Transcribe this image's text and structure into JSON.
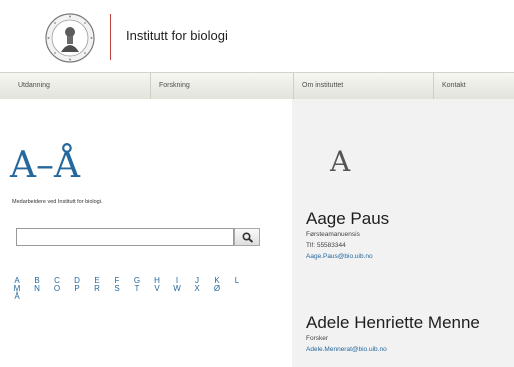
{
  "header": {
    "site_title": "Institutt for biologi"
  },
  "nav": {
    "items": [
      {
        "label": "Utdanning"
      },
      {
        "label": "Forskning"
      },
      {
        "label": "Om instituttet"
      },
      {
        "label": "Kontakt"
      }
    ]
  },
  "main": {
    "az_title": "A–Å",
    "intro": "Medarbeidere ved Institutt for biologi.",
    "search": {
      "value": "",
      "placeholder": ""
    },
    "letters_row1": [
      "A",
      "B",
      "C",
      "D",
      "E",
      "F",
      "G",
      "H",
      "I",
      "J",
      "K",
      "L"
    ],
    "letters_row2": [
      "M",
      "N",
      "O",
      "P",
      "R",
      "S",
      "T",
      "V",
      "W",
      "X",
      "Ø"
    ],
    "letters_row3": [
      "Å"
    ]
  },
  "directory": {
    "section_letter": "A",
    "people": [
      {
        "name": "Aage Paus",
        "title": "Førsteamanuensis",
        "phone": "Tlf: 55583344",
        "email": "Aage.Paus@bio.uib.no"
      },
      {
        "name": "Adele Henriette Menne",
        "title": "Forsker",
        "phone": "",
        "email": "Adele.Mennerat@bio.uib.no"
      }
    ]
  },
  "colors": {
    "accent": "#24689e",
    "divider": "#c33c3c",
    "nav_bg": "#e9e9e3",
    "right_bg": "#f2f2f2"
  },
  "icons": {
    "logo": "university-seal-icon",
    "search": "search-icon"
  }
}
